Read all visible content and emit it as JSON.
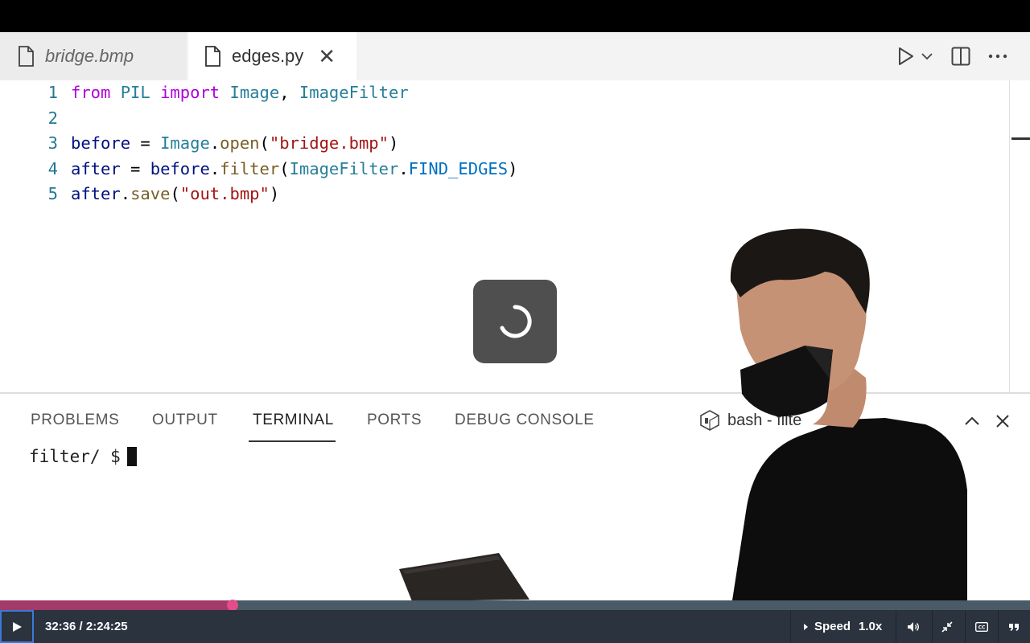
{
  "editor": {
    "tabs": [
      {
        "label": "bridge.bmp",
        "active": false
      },
      {
        "label": "edges.py",
        "active": true
      }
    ],
    "close_glyph": "✕",
    "lines": [
      {
        "num": "1",
        "tokens": [
          {
            "t": "from",
            "c": "kw"
          },
          {
            "t": " ",
            "c": "punc"
          },
          {
            "t": "PIL",
            "c": "mod"
          },
          {
            "t": " ",
            "c": "punc"
          },
          {
            "t": "import",
            "c": "kw"
          },
          {
            "t": " ",
            "c": "punc"
          },
          {
            "t": "Image",
            "c": "cls"
          },
          {
            "t": ", ",
            "c": "punc"
          },
          {
            "t": "ImageFilter",
            "c": "cls"
          }
        ]
      },
      {
        "num": "2",
        "tokens": []
      },
      {
        "num": "3",
        "tokens": [
          {
            "t": "before",
            "c": "var"
          },
          {
            "t": " = ",
            "c": "punc"
          },
          {
            "t": "Image",
            "c": "cls"
          },
          {
            "t": ".",
            "c": "punc"
          },
          {
            "t": "open",
            "c": "fn"
          },
          {
            "t": "(",
            "c": "punc"
          },
          {
            "t": "\"bridge.bmp\"",
            "c": "str"
          },
          {
            "t": ")",
            "c": "punc"
          }
        ]
      },
      {
        "num": "4",
        "tokens": [
          {
            "t": "after",
            "c": "var"
          },
          {
            "t": " = ",
            "c": "punc"
          },
          {
            "t": "before",
            "c": "var"
          },
          {
            "t": ".",
            "c": "punc"
          },
          {
            "t": "filter",
            "c": "fn"
          },
          {
            "t": "(",
            "c": "punc"
          },
          {
            "t": "ImageFilter",
            "c": "cls"
          },
          {
            "t": ".",
            "c": "punc"
          },
          {
            "t": "FIND_EDGES",
            "c": "const"
          },
          {
            "t": ")",
            "c": "punc"
          }
        ]
      },
      {
        "num": "5",
        "tokens": [
          {
            "t": "after",
            "c": "var"
          },
          {
            "t": ".",
            "c": "punc"
          },
          {
            "t": "save",
            "c": "fn"
          },
          {
            "t": "(",
            "c": "punc"
          },
          {
            "t": "\"out.bmp\"",
            "c": "str"
          },
          {
            "t": ")",
            "c": "punc"
          }
        ]
      }
    ]
  },
  "panel": {
    "tabs": [
      "PROBLEMS",
      "OUTPUT",
      "TERMINAL",
      "PORTS",
      "DEBUG CONSOLE"
    ],
    "active_tab": "TERMINAL",
    "terminal_label": "bash - filte",
    "prompt": "filter/ $"
  },
  "player": {
    "time": "32:36 / 2:24:25",
    "progress_fraction": 0.2257,
    "speed_label": "Speed",
    "speed_value": "1.0x",
    "accent_color": "#e34d8a"
  }
}
